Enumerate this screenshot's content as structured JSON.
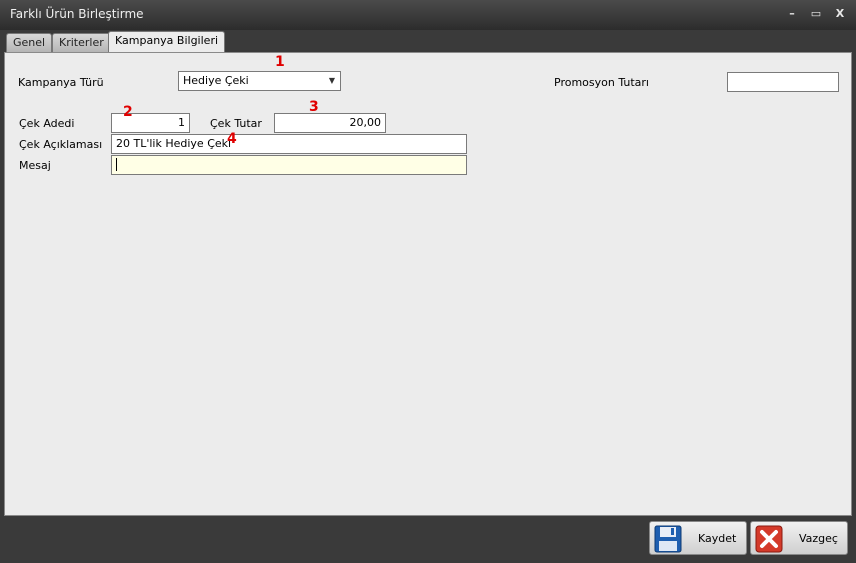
{
  "window": {
    "title": "Farklı Ürün Birleştirme"
  },
  "titlebar_buttons": {
    "minimize": "–",
    "maximize": "▭",
    "close": "X"
  },
  "tabs": [
    {
      "label": "Genel"
    },
    {
      "label": "Kriterler"
    },
    {
      "label": "Kampanya Bilgileri"
    }
  ],
  "form": {
    "kampanya_turu_label": "Kampanya Türü",
    "kampanya_turu_value": "Hediye Çeki",
    "promosyon_tutari_label": "Promosyon Tutarı",
    "promosyon_tutari_value": "",
    "cek_adedi_label": "Çek Adedi",
    "cek_adedi_value": "1",
    "cek_tutar_label": "Çek Tutar",
    "cek_tutar_value": "20,00",
    "cek_aciklamasi_label": "Çek Açıklaması",
    "cek_aciklamasi_value": "20 TL'lik Hediye Çeki",
    "mesaj_label": "Mesaj",
    "mesaj_value": ""
  },
  "markers": [
    "1",
    "2",
    "3",
    "4"
  ],
  "footer": {
    "save_label": "Kaydet",
    "cancel_label": "Vazgeç"
  },
  "colors": {
    "message_field_bg": "#ffffe6",
    "marker": "#e00000"
  }
}
